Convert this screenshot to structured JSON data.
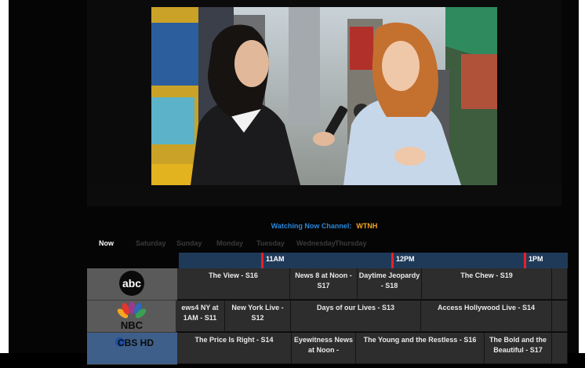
{
  "player": {
    "watching_label": "Watching Now Channel:",
    "watching_channel": "WTNH"
  },
  "day_tabs": [
    "Now",
    "Saturday",
    "Sunday",
    "Monday",
    "Tuesday",
    "Wednesday",
    "Thursday"
  ],
  "time_ruler": [
    "11AM",
    "12PM",
    "1PM"
  ],
  "channels": [
    {
      "logo": "abc",
      "programs": [
        "The View - S16",
        "News 8 at Noon - S17",
        "Daytime Jeopardy - S18",
        "The Chew - S19"
      ]
    },
    {
      "logo": "NBC",
      "programs": [
        "ews4 NY at 1AM - S11",
        "New York Live - S12",
        "Days of our Lives - S13",
        "Access Hollywood Live - S14"
      ]
    },
    {
      "logo": "CBS HD",
      "programs": [
        "The Price Is Right - S14",
        "Eyewitness News at Noon -",
        "The Young and the Restless - S16",
        "The Bold and the Beautiful - S17"
      ]
    }
  ],
  "colors": {
    "watching_label": "#2a86d8",
    "watching_channel": "#f5a623",
    "ruler_bg": "#1f3a59",
    "now_marker": "#e8202c"
  }
}
